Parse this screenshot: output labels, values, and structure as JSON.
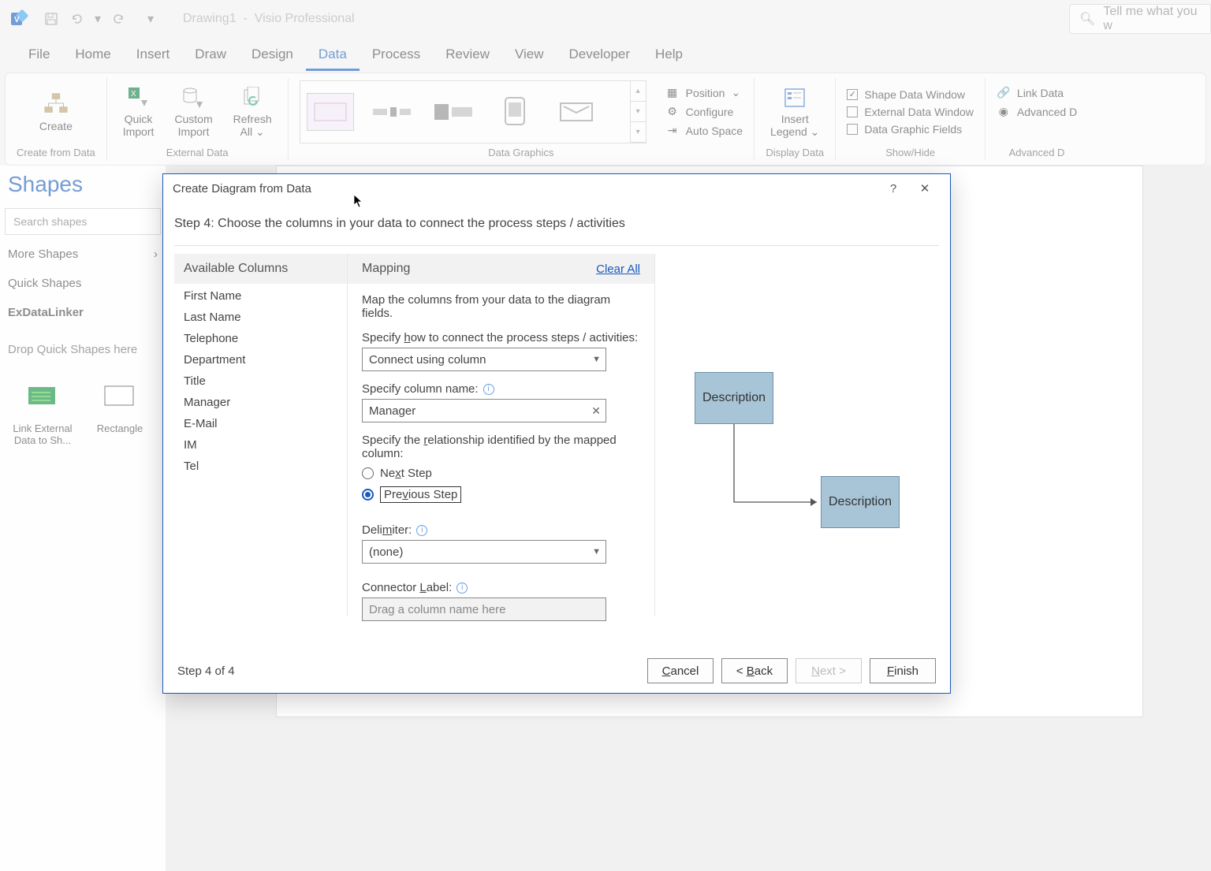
{
  "titlebar": {
    "doc_title": "Drawing1",
    "app_name": "Visio Professional",
    "tell_me_placeholder": "Tell me what you w"
  },
  "tabs": {
    "file": "File",
    "home": "Home",
    "insert": "Insert",
    "draw": "Draw",
    "design": "Design",
    "data": "Data",
    "process": "Process",
    "review": "Review",
    "view": "View",
    "developer": "Developer",
    "help": "Help"
  },
  "ribbon": {
    "create_from_data": "Create from Data",
    "create": "Create",
    "external_data": "External Data",
    "quick_import": "Quick Import",
    "custom_import": "Custom Import",
    "refresh_all": "Refresh All",
    "data_graphics": "Data Graphics",
    "position": "Position",
    "configure": "Configure",
    "auto_space": "Auto Space",
    "display_data": "Display Data",
    "insert_legend": "Insert Legend",
    "show_hide": "Show/Hide",
    "shape_data_window": "Shape Data Window",
    "external_data_window": "External Data Window",
    "data_graphic_fields": "Data Graphic Fields",
    "link_data": "Link Data",
    "advanced_d": "Advanced D",
    "advanced_group": "Advanced D"
  },
  "shapes": {
    "title": "Shapes",
    "search_placeholder": "Search shapes",
    "more_shapes": "More Shapes",
    "quick_shapes": "Quick Shapes",
    "exdatalinker": "ExDataLinker",
    "drop_hint": "Drop Quick Shapes here",
    "item1": "Link  External Data to Sh...",
    "item2": "Rectangle"
  },
  "dialog": {
    "title": "Create Diagram from Data",
    "help": "?",
    "step_desc": "Step 4: Choose the columns in your data to connect the process steps / activities",
    "available_columns": "Available Columns",
    "cols": {
      "c1": "First Name",
      "c2": "Last Name",
      "c3": "Telephone",
      "c4": "Department",
      "c5": "Title",
      "c6": "Manager",
      "c7": "E-Mail",
      "c8": "IM",
      "c9": "Tel"
    },
    "mapping": "Mapping",
    "clear_all": "Clear All",
    "map_desc": "Map the columns from your data to the diagram fields.",
    "specify_how_pre": "Specify ",
    "specify_how_u": "h",
    "specify_how_post": "ow to connect the process steps / activities:",
    "connect_using": "Connect using column",
    "specify_column": "Specify column name:",
    "column_value": "Manager",
    "specify_rel_pre": "Specify the ",
    "specify_rel_u": "r",
    "specify_rel_post": "elationship identified by the mapped column:",
    "next_step_pre": "Ne",
    "next_step_u": "x",
    "next_step_post": "t Step",
    "prev_step_pre": "Pre",
    "prev_step_u": "v",
    "prev_step_post": "ious Step",
    "delimiter_pre": "Deli",
    "delimiter_u": "m",
    "delimiter_post": "iter:",
    "delimiter_value": "(none)",
    "connector_label_pre": "Connector ",
    "connector_label_u": "L",
    "connector_label_post": "abel:",
    "connector_placeholder": "Drag a column name here",
    "preview1": "Description",
    "preview2": "Description",
    "step_n": "Step 4 of 4",
    "cancel_u": "C",
    "cancel_post": "ancel",
    "back_pre": "< ",
    "back_u": "B",
    "back_post": "ack",
    "next_u": "N",
    "next_post": "ext >",
    "finish_u": "F",
    "finish_post": "inish"
  }
}
